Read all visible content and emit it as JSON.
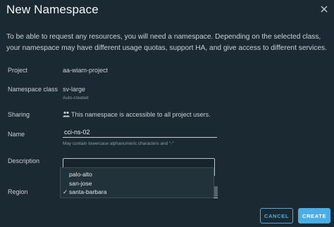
{
  "modal": {
    "title": "New Namespace",
    "intro": "To be able to request any resources, you will need a namespace. Depending on the selected class, your namespace may have different usage quotas, support HA, and give access to different services."
  },
  "fields": {
    "project": {
      "label": "Project",
      "value": "aa-wiam-project"
    },
    "namespace_class": {
      "label": "Namespace class",
      "value": "sv-large",
      "hint": "Auto-created"
    },
    "sharing": {
      "label": "Sharing",
      "value": "This namespace is accessible to all project users."
    },
    "name": {
      "label": "Name",
      "value": "cci-ns-02",
      "hint": "May contain lowercase alphanumeric characters and \"-\""
    },
    "description": {
      "label": "Description",
      "value": ""
    },
    "region": {
      "label": "Region",
      "options": [
        "palo-alto",
        "san-jose",
        "santa-barbara"
      ],
      "selected": "santa-barbara",
      "check_glyph": "✓"
    }
  },
  "buttons": {
    "cancel": "CANCEL",
    "create": "CREATE"
  },
  "colors": {
    "background": "#1b2a32",
    "accent": "#49aee6",
    "text": "#c7d0d5"
  },
  "icons": {
    "close": "close-icon",
    "users": "users-icon",
    "check": "check-icon"
  }
}
